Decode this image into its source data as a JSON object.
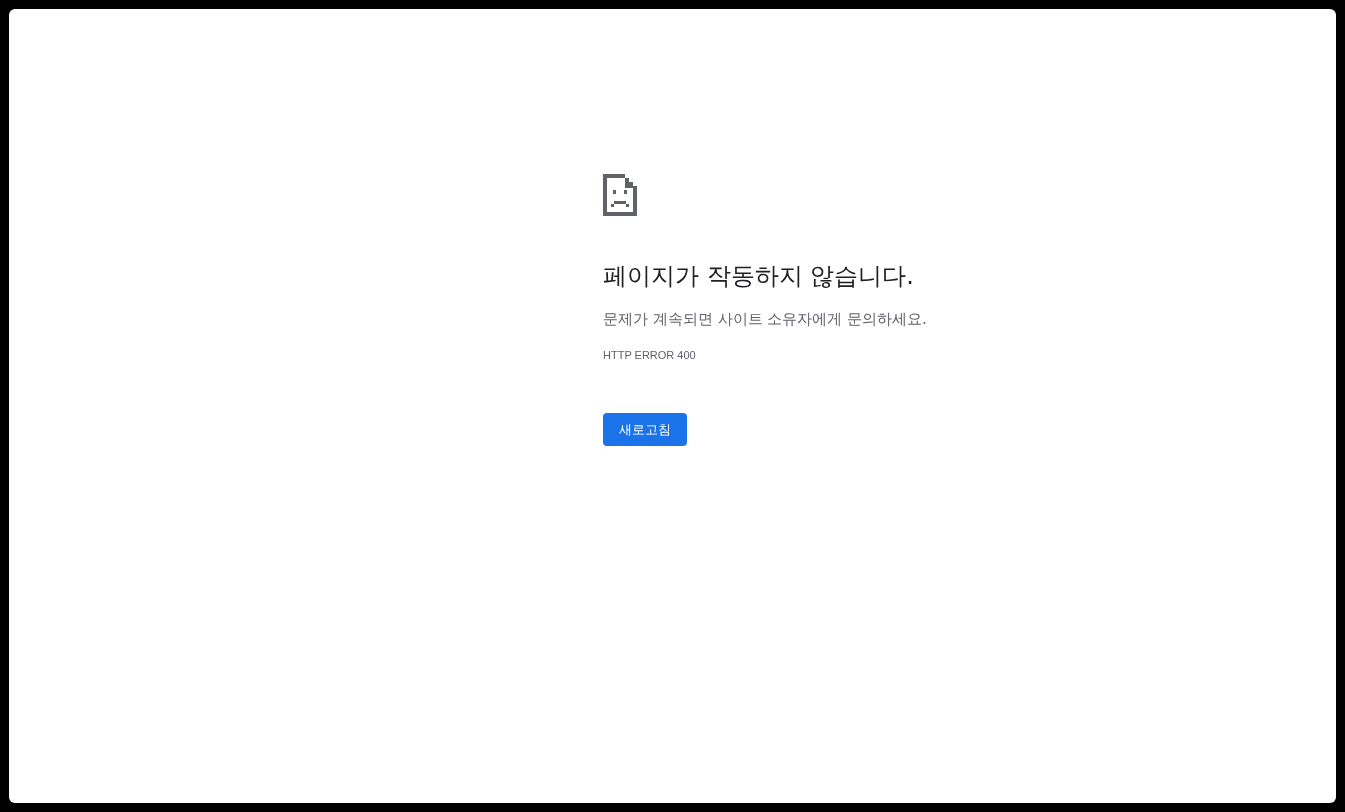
{
  "heading": "페이지가 작동하지 않습니다.",
  "message": "문제가 계속되면 사이트 소유자에게 문의하세요.",
  "error_code": "HTTP ERROR 400",
  "buttons": [
    {
      "label": "새로고침"
    }
  ]
}
